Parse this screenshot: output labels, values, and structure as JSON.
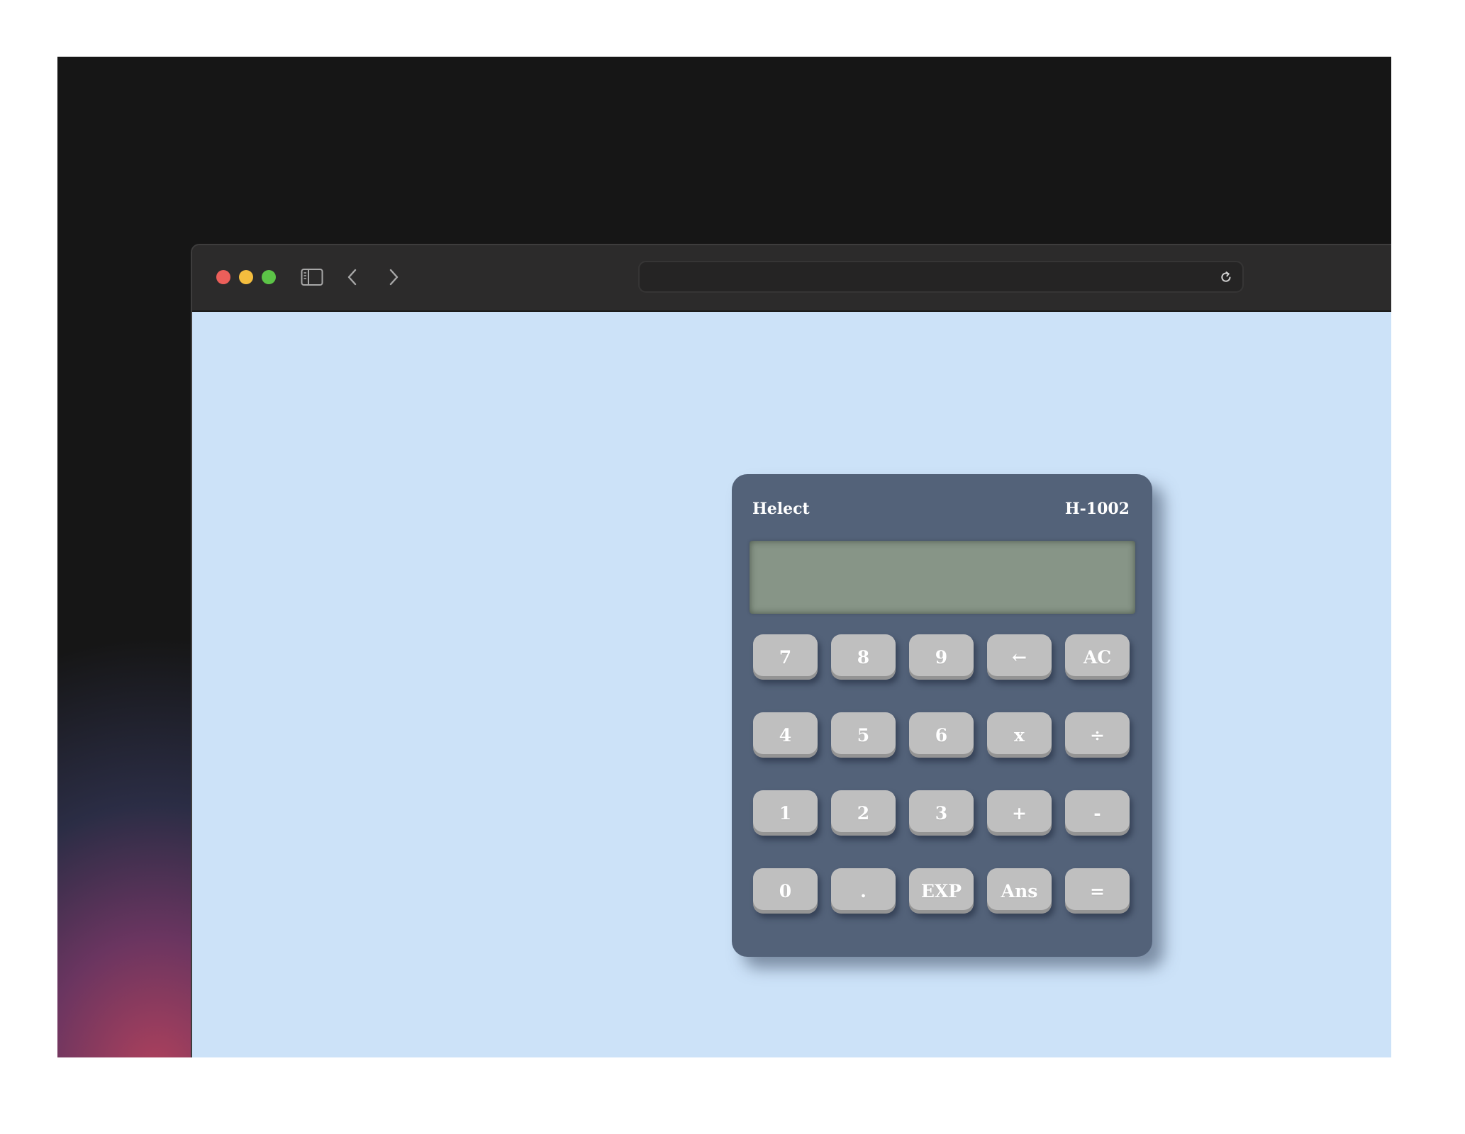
{
  "browser": {
    "url": "",
    "traffic_lights": [
      "#ec5f5a",
      "#f4bd3e",
      "#5cc447"
    ],
    "icons": {
      "sidebar": "sidebar-icon",
      "back": "chevron-left-icon",
      "forward": "chevron-right-icon",
      "reload": "reload-icon"
    }
  },
  "calculator": {
    "brand": "Helect",
    "model": "H-1002",
    "display_value": "",
    "colors": {
      "body": "#536279",
      "display": "#879587",
      "key": "#bfbfbf",
      "page_background": "#cce2f8"
    },
    "keys": {
      "k7": "7",
      "k8": "8",
      "k9": "9",
      "backspace": "←",
      "clear": "AC",
      "k4": "4",
      "k5": "5",
      "k6": "6",
      "multiply": "x",
      "divide": "÷",
      "k1": "1",
      "k2": "2",
      "k3": "3",
      "add": "+",
      "subtract": "-",
      "k0": "0",
      "decimal": ".",
      "exp": "EXP",
      "ans": "Ans",
      "equals": "="
    }
  }
}
